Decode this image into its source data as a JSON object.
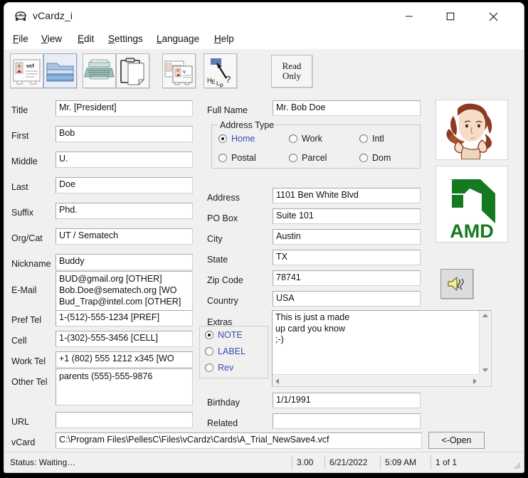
{
  "window": {
    "title": "vCardz_i",
    "icon": "app-card-icon",
    "controls": {
      "minimize": "minimize-icon",
      "maximize": "maximize-icon",
      "close": "close-icon"
    }
  },
  "menubar": {
    "items": [
      {
        "label": "File",
        "accel": "F",
        "rest": "ile"
      },
      {
        "label": "View",
        "accel": "V",
        "rest": "iew"
      },
      {
        "label": "Edit",
        "accel": "E",
        "rest": "dit"
      },
      {
        "label": "Settings",
        "accel": "S",
        "rest": "ettings"
      },
      {
        "label": "Language",
        "accel": "L",
        "rest": "anguage"
      },
      {
        "label": "Help",
        "accel": "H",
        "rest": "elp"
      }
    ]
  },
  "toolbar": {
    "buttons": [
      {
        "name": "new-vcf-card",
        "icon": "vcf-card-icon"
      },
      {
        "name": "open-folder",
        "icon": "folder-open-icon"
      },
      {
        "name": "typewriter-edit",
        "icon": "typewriter-icon"
      },
      {
        "name": "clipboard-paste",
        "icon": "clipboard-icon"
      },
      {
        "name": "duplicate-card",
        "icon": "two-cards-icon"
      },
      {
        "name": "help",
        "icon": "help-arrow-icon"
      }
    ],
    "read_only_label": "Read\nOnly",
    "read_only_line1": "Read",
    "read_only_line2": "Only"
  },
  "left_form": {
    "fields": [
      {
        "label": "Title",
        "value": "Mr. [President]"
      },
      {
        "label": "First",
        "value": "Bob"
      },
      {
        "label": "Middle",
        "value": "U."
      },
      {
        "label": "Last",
        "value": "Doe"
      },
      {
        "label": "Suffix",
        "value": "Phd."
      },
      {
        "label": "Org/Cat",
        "value": "UT / Sematech"
      },
      {
        "label": "Nickname",
        "value": "Buddy"
      }
    ],
    "email": {
      "label": "E-Mail",
      "value": "BUD@gmail.org [OTHER]\nBob.Doe@sematech.org [WO\nBud_Trap@intel.com [OTHER]"
    },
    "phones": [
      {
        "label": "Pref Tel",
        "value": "1-(512)-555-1234 [PREF]"
      },
      {
        "label": "Cell",
        "value": "1-(302)-555-3456 [CELL]"
      },
      {
        "label": "Work Tel",
        "value": "+1 (802) 555 1212 x345 [WO"
      }
    ],
    "other_tel": {
      "label": "Other Tel",
      "value": "parents (555)-555-9876"
    },
    "url": {
      "label": "URL",
      "value": ""
    },
    "vcard": {
      "label": "vCard",
      "value": "C:\\Program Files\\PellesC\\Files\\vCardz\\Cards\\A_Trial_NewSave4.vcf"
    },
    "open_button": "<-Open"
  },
  "right_form": {
    "full_name": {
      "label": "Full Name",
      "value": "Mr. Bob Doe"
    },
    "address_type": {
      "title": "Address Type",
      "options": [
        {
          "label": "Home",
          "selected": true
        },
        {
          "label": "Work",
          "selected": false
        },
        {
          "label": "Intl",
          "selected": false
        },
        {
          "label": "Postal",
          "selected": false
        },
        {
          "label": "Parcel",
          "selected": false
        },
        {
          "label": "Dom",
          "selected": false
        }
      ]
    },
    "fields": [
      {
        "label": "Address",
        "value": "1101 Ben White Blvd"
      },
      {
        "label": "PO Box",
        "value": "Suite 101"
      },
      {
        "label": "City",
        "value": "Austin"
      },
      {
        "label": "State",
        "value": "TX"
      },
      {
        "label": "Zip Code",
        "value": "78741"
      },
      {
        "label": "Country",
        "value": "USA"
      }
    ],
    "extras": {
      "label": "Extras",
      "options": [
        {
          "label": "NOTE",
          "selected": true
        },
        {
          "label": "LABEL",
          "selected": false
        },
        {
          "label": "Rev",
          "selected": false
        }
      ],
      "memo": "This is just a made\nup card you know\n;-)"
    },
    "birthday": {
      "label": "Birthday",
      "value": "1/1/1991"
    },
    "related": {
      "label": "Related",
      "value": ""
    }
  },
  "side_panel": {
    "photo": "woman-on-telephone-photo",
    "logo": "amd-logo",
    "logo_text": "AMD",
    "sound_button": "speaker-icon"
  },
  "statusbar": {
    "status": "Status: Waiting…",
    "version": "3.00",
    "date": "6/21/2022",
    "time": "5:09 AM",
    "count": "1 of 1"
  },
  "colors": {
    "accent_blue": "#3b4fb0",
    "amd_green": "#14791f",
    "window_bg": "#f0f0f0",
    "field_bg": "#ffffff"
  }
}
